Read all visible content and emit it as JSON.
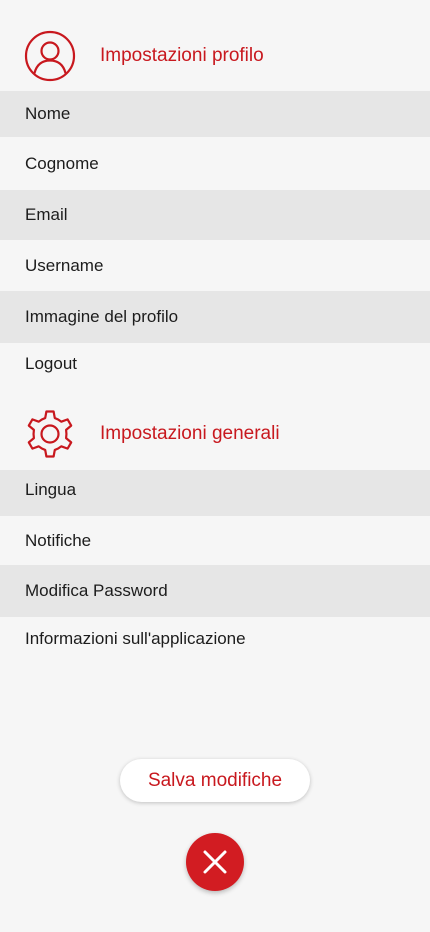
{
  "profile_section": {
    "title": "Impostazioni profilo",
    "icon": "user-circle-icon",
    "items": [
      {
        "label": "Nome"
      },
      {
        "label": "Cognome"
      },
      {
        "label": "Email"
      },
      {
        "label": "Username"
      },
      {
        "label": "Immagine del profilo"
      },
      {
        "label": "Logout"
      }
    ]
  },
  "general_section": {
    "title": "Impostazioni generali",
    "icon": "gear-icon",
    "items": [
      {
        "label": "Lingua"
      },
      {
        "label": "Notifiche"
      },
      {
        "label": "Modifica Password"
      },
      {
        "label": "Informazioni sull'applicazione"
      }
    ]
  },
  "actions": {
    "save_label": "Salva modifiche",
    "close_icon": "close-icon"
  },
  "colors": {
    "accent": "#c8181e",
    "background": "#f6f6f6",
    "row_shaded": "#e6e6e6"
  }
}
